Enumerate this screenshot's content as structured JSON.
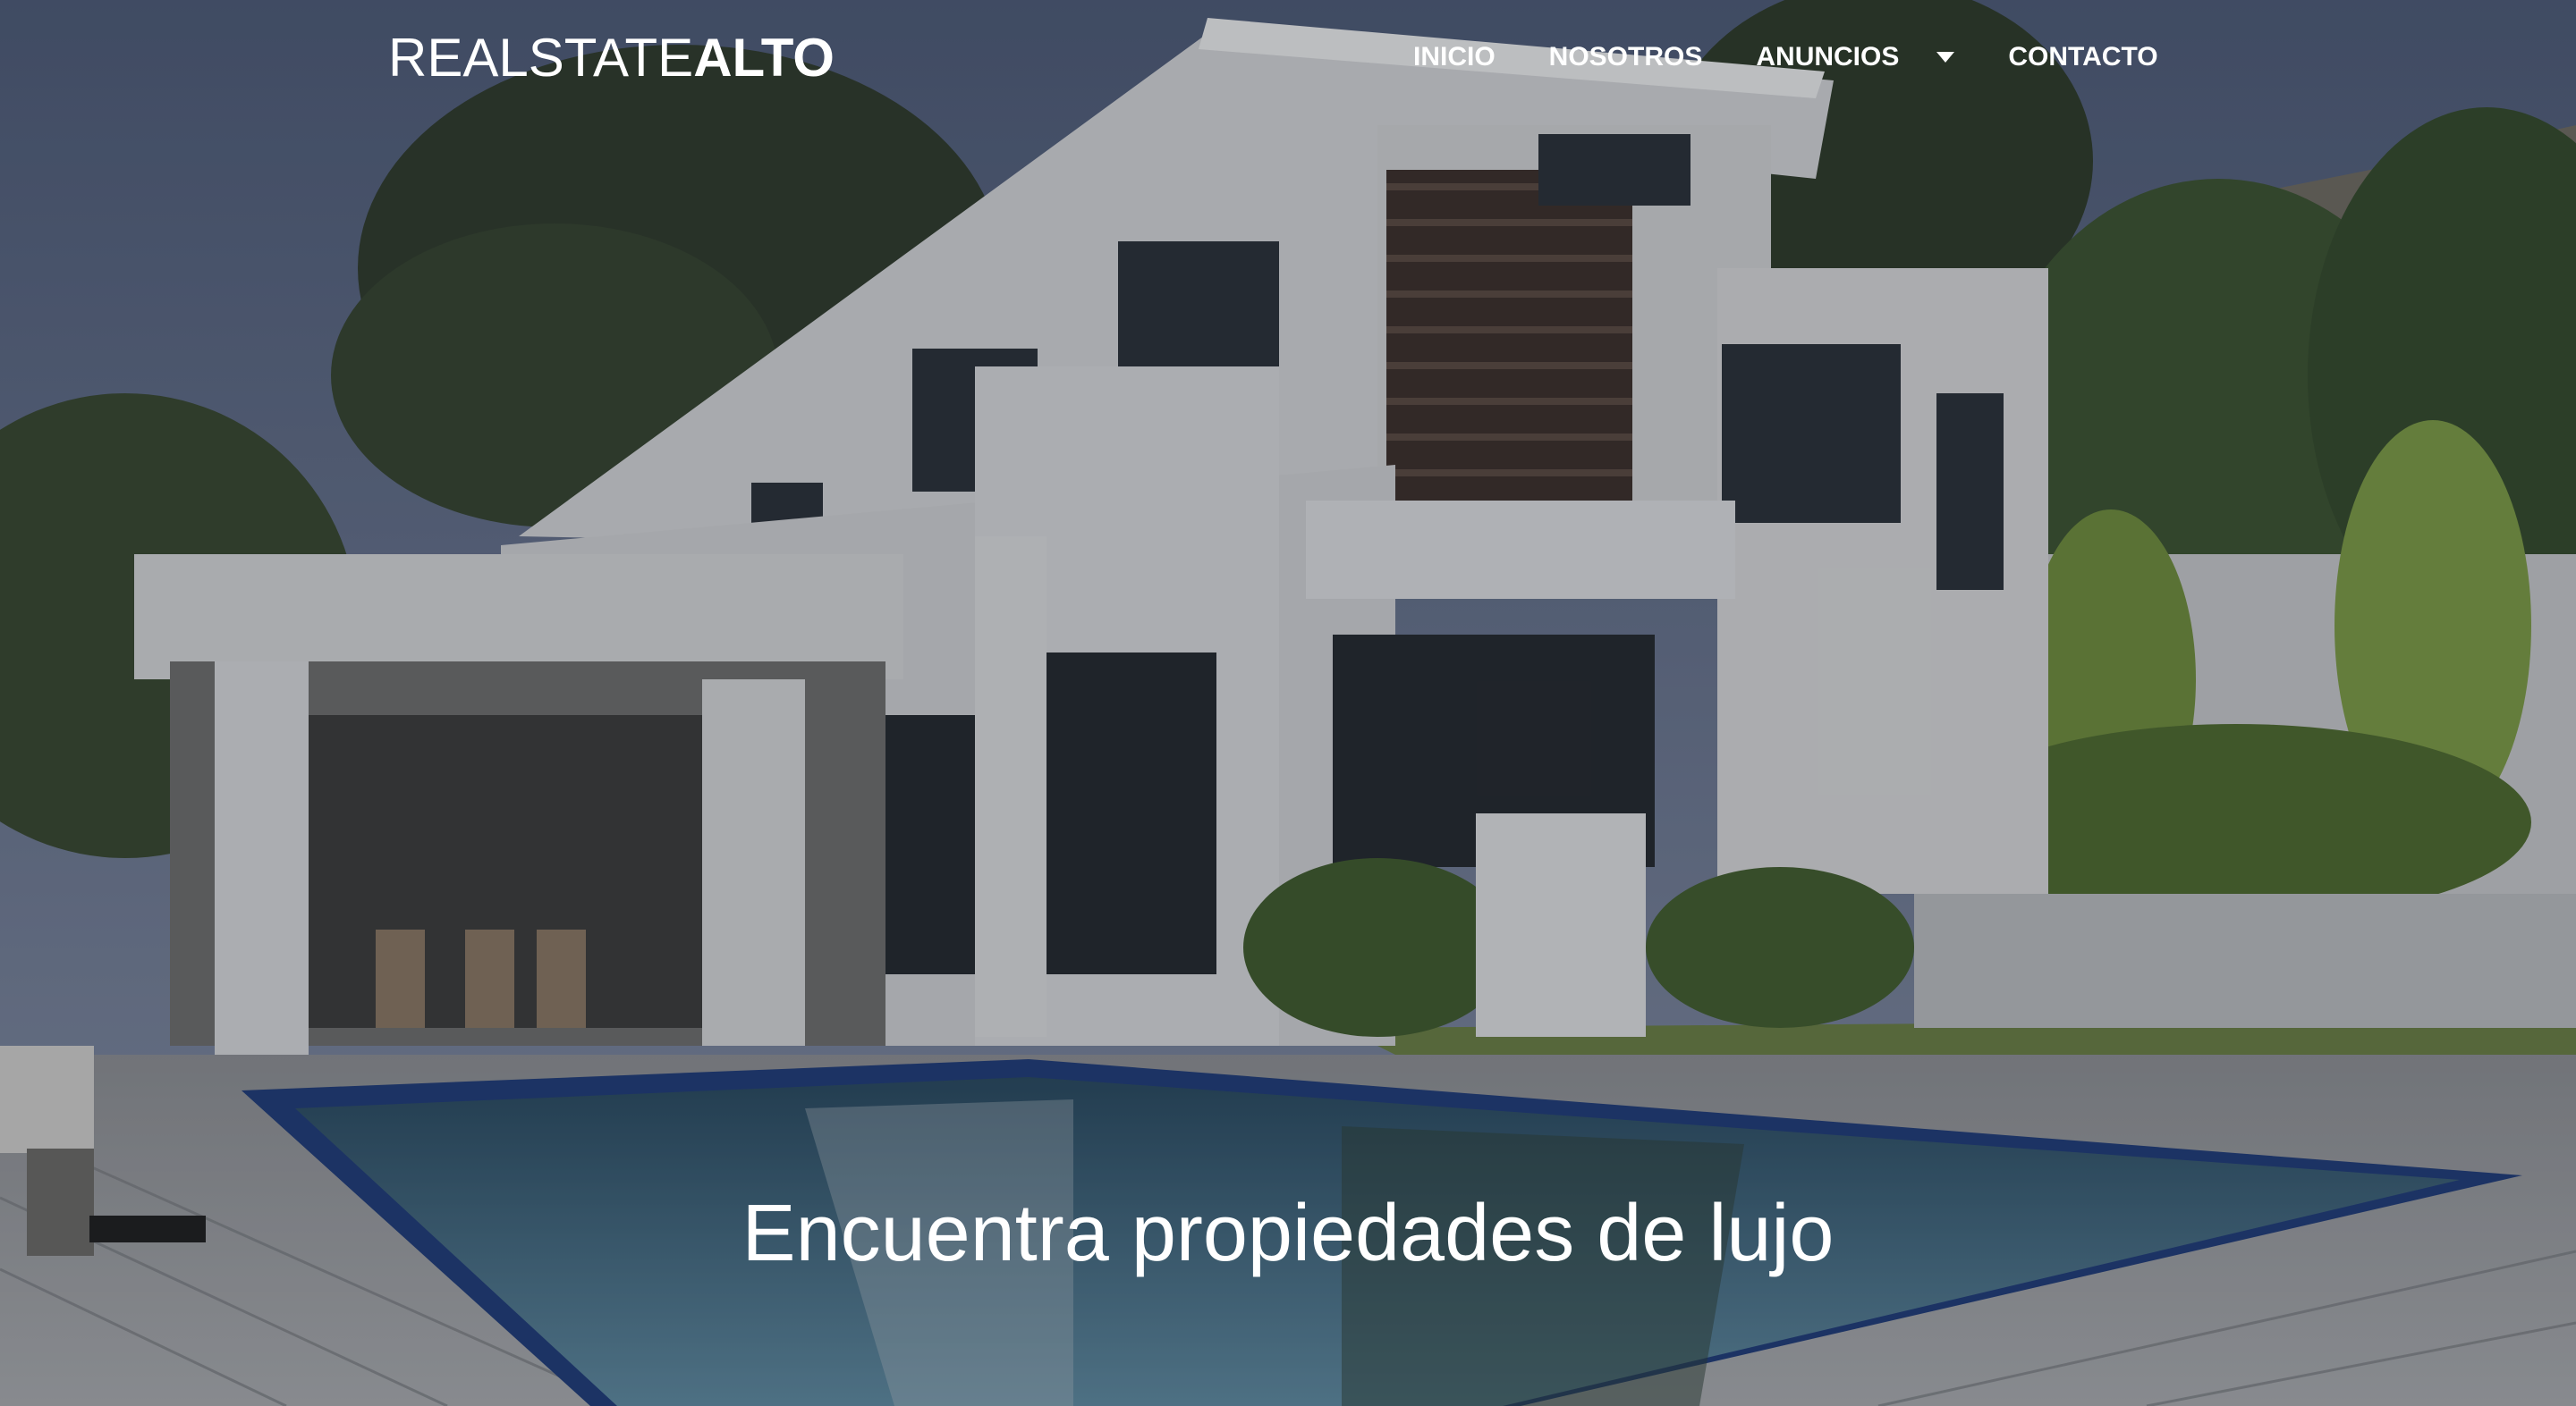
{
  "brand": {
    "light": "REALSTATE",
    "bold": "ALTO"
  },
  "nav": {
    "items": [
      {
        "label": "INICIO"
      },
      {
        "label": "NOSOTROS"
      },
      {
        "label": "ANUNCIOS",
        "has_dropdown": true
      },
      {
        "label": "CONTACTO"
      }
    ]
  },
  "hero": {
    "title": "Encuentra propiedades de lujo",
    "image_subject": "modern white luxury house with swimming pool"
  },
  "colors": {
    "text": "#ffffff",
    "sky": "#5b6a86",
    "pool": "#3f6a82",
    "house": "#cfd0d2"
  }
}
